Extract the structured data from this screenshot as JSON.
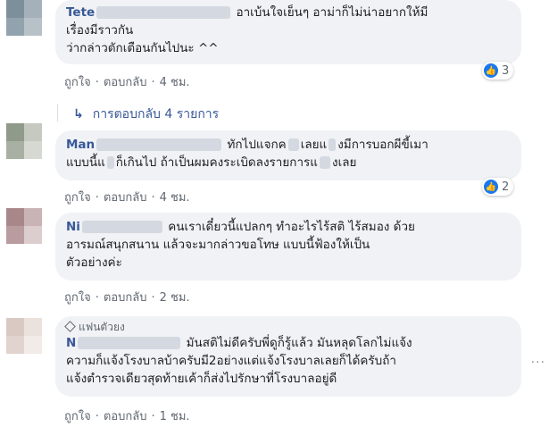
{
  "comments": [
    {
      "author_visible": "Tete",
      "lines": [
        "อาเบ้นใจเย็นๆ อาม่าก็ไม่น่าอยากให้มี",
        "เรื่องมีราวกัน",
        "ว่ากล่าวตักเตือนกันไปนะ ^^"
      ],
      "actions": {
        "like": "ถูกใจ",
        "reply": "ตอบกลับ",
        "time": "4 ชม."
      },
      "reaction_count": "3",
      "avatar_colors": [
        "#7e8f9c",
        "#a4b1bb",
        "#93a3ae",
        "#b6c1c8"
      ]
    },
    {
      "author_visible": "Man",
      "lines": [
        "ทักไปแจกค",
        "เลยแ",
        "งมีการบอกผีขี้เมา",
        "แบบนี้แ",
        "ก็เกินไป ถ้าเป็นผมคงระเบิดลงรายการแ",
        "งเลย"
      ],
      "actions": {
        "like": "ถูกใจ",
        "reply": "ตอบกลับ",
        "time": "4 ชม."
      },
      "reaction_count": "2",
      "avatar_colors": [
        "#8f9a8a",
        "#c5c9c0",
        "#a9b0a3",
        "#d6d9d2"
      ]
    },
    {
      "author_visible": "Ni",
      "lines": [
        "คนเราเดี๋ยวนี้แปลกๆ ทำอะไรไร้สติ ไร้สมอง ด้วย",
        "อารมณ์สนุกสนาน แล้วจะมากล่าวขอโทษ แบบนี้ฟ้องให้เป็น",
        "ตัวอย่างค่ะ"
      ],
      "actions": {
        "like": "ถูกใจ",
        "reply": "ตอบกลับ",
        "time": "2 ชม."
      },
      "avatar_colors": [
        "#a8878a",
        "#c9b3b4",
        "#b99c9f",
        "#dccdce"
      ]
    },
    {
      "badge": "แฟนตัวยง",
      "author_visible": "N",
      "lines": [
        "มันสติไม่ดีครับพี่ดูก็รู้แล้ว มันหลุดโลกไม่แจ้ง",
        "ความก็แจ้งโรงบาลบ้าครับมี2อย่างแต่แจ้งโรงบาลเลยก็ได้ครับถ้า",
        "แจ้งตำรวจเดียวสุดท้ายเค้าก็ส่งไปรักษาที่โรงบาลอยู่ดี"
      ],
      "actions": {
        "like": "ถูกใจ",
        "reply": "ตอบกลับ",
        "time": "1 ชม."
      },
      "avatar_colors": [
        "#d9c9c3",
        "#ebe1dd",
        "#e1d3ce",
        "#f2ebe8"
      ]
    }
  ],
  "replies_link": "การตอบกลับ 4 รายการ",
  "icons": {
    "like": "thumbs-up-icon",
    "reply_arrow": "reply-arrow-icon",
    "more": "more-options-icon",
    "badge": "diamond-icon"
  },
  "colors": {
    "bubble": "#f0f2f5",
    "author": "#385898",
    "meta": "#606770",
    "like_blue": "#1877f2"
  }
}
